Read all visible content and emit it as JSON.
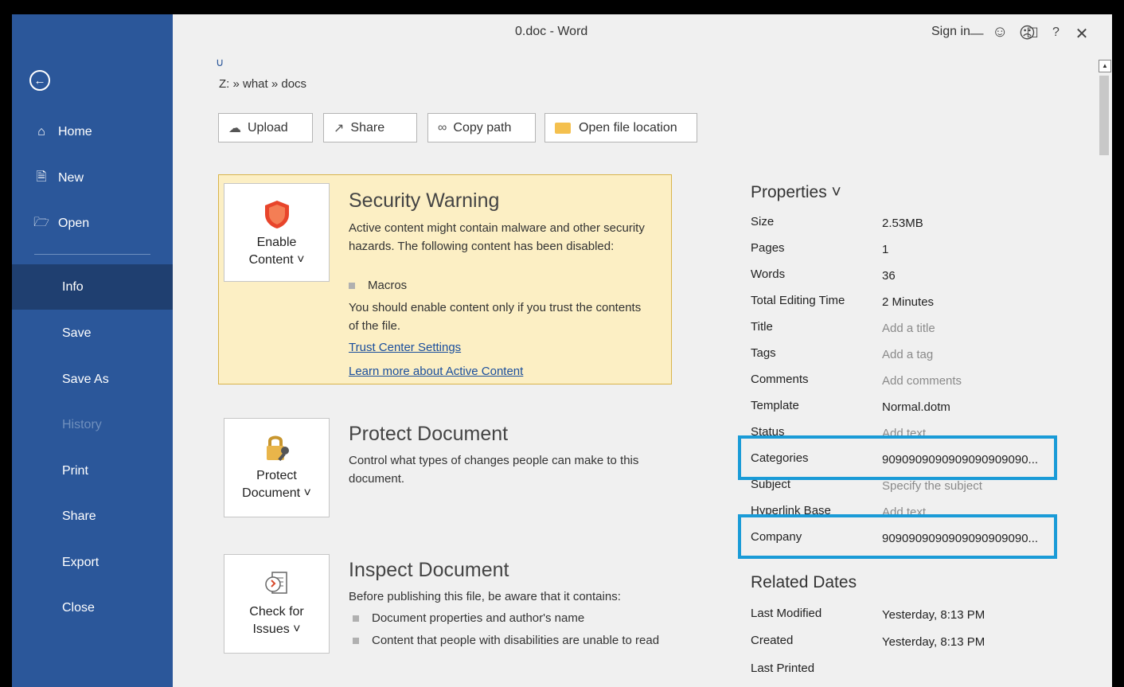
{
  "window": {
    "title": "0.doc  -  Word",
    "sign_in": "Sign in"
  },
  "sidebar": {
    "items": [
      {
        "label": "Home",
        "icon": "home-icon"
      },
      {
        "label": "New",
        "icon": "new-document-icon"
      },
      {
        "label": "Open",
        "icon": "folder-open-icon"
      },
      {
        "label": "Info",
        "active": true
      },
      {
        "label": "Save"
      },
      {
        "label": "Save As"
      },
      {
        "label": "History",
        "disabled": true
      },
      {
        "label": "Print"
      },
      {
        "label": "Share"
      },
      {
        "label": "Export"
      },
      {
        "label": "Close"
      }
    ]
  },
  "breadcrumb": "Z: » what » docs",
  "toolbar": {
    "upload": "Upload",
    "share": "Share",
    "copy_path": "Copy path",
    "open_location": "Open file location"
  },
  "security": {
    "tile_line1": "Enable",
    "tile_line2": "Content ˅",
    "heading": "Security Warning",
    "text": "Active content might contain malware and other security hazards. The following content has been disabled:",
    "bullet": "Macros",
    "advice": "You should enable content only if you trust the contents of the file.",
    "link1": "Trust Center Settings",
    "link2": "Learn more about Active Content"
  },
  "protect": {
    "tile_line1": "Protect",
    "tile_line2": "Document ˅",
    "heading": "Protect Document",
    "text": "Control what types of changes people can make to this document."
  },
  "inspect": {
    "tile_line1": "Check for",
    "tile_line2": "Issues ˅",
    "heading": "Inspect Document",
    "text": "Before publishing this file, be aware that it contains:",
    "bullet1": "Document properties and author's name",
    "bullet2": "Content that people with disabilities are unable to read"
  },
  "properties": {
    "heading": "Properties ˅",
    "rows": [
      {
        "label": "Size",
        "value": "2.53MB"
      },
      {
        "label": "Pages",
        "value": "1"
      },
      {
        "label": "Words",
        "value": "36"
      },
      {
        "label": "Total Editing Time",
        "value": "2 Minutes"
      },
      {
        "label": "Title",
        "value": "Add a title"
      },
      {
        "label": "Tags",
        "value": "Add a tag"
      },
      {
        "label": "Comments",
        "value": "Add comments"
      },
      {
        "label": "Template",
        "value": "Normal.dotm"
      },
      {
        "label": "Status",
        "value": "Add text"
      },
      {
        "label": "Categories",
        "value": "9090909090909090909090..."
      },
      {
        "label": "Subject",
        "value": "Specify the subject"
      },
      {
        "label": "Hyperlink Base",
        "value": "Add text"
      },
      {
        "label": "Company",
        "value": "9090909090909090909090..."
      }
    ]
  },
  "related_dates": {
    "heading": "Related Dates",
    "rows": [
      {
        "label": "Last Modified",
        "value": "Yesterday, 8:13 PM"
      },
      {
        "label": "Created",
        "value": "Yesterday, 8:13 PM"
      },
      {
        "label": "Last Printed",
        "value": ""
      }
    ]
  },
  "colors": {
    "sidebar": "#2b579a",
    "sidebar_active": "#1f3f70",
    "warning_bg": "#fcefc4",
    "highlight": "#1a9bd7"
  }
}
